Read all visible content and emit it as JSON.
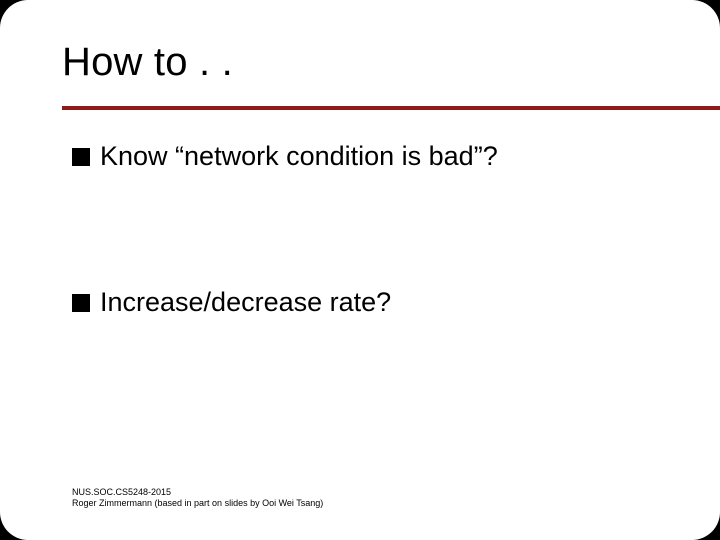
{
  "title": "How to . .",
  "bullets": [
    {
      "text": "Know “network condition is bad”?"
    },
    {
      "text": "Increase/decrease rate?"
    }
  ],
  "footer": {
    "line1": "NUS.SOC.CS5248-2015",
    "line2": "Roger Zimmermann (based in part on slides by Ooi Wei Tsang)"
  },
  "colors": {
    "rule": "#8e1a1a"
  }
}
